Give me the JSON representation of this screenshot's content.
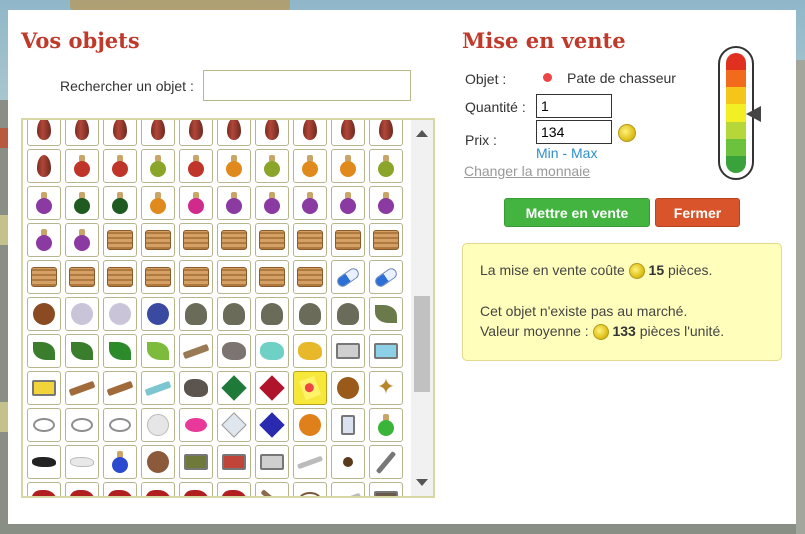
{
  "left_panel": {
    "title": "Vos objets",
    "search_label": "Rechercher un objet :",
    "search_value": ""
  },
  "grid": {
    "items": [
      "seed",
      "seed",
      "seed",
      "seed",
      "seed",
      "seed",
      "seed",
      "seed",
      "seed",
      "seed",
      "seed",
      "potion-red",
      "potion-red",
      "potion-green",
      "potion-red",
      "potion-orange",
      "potion-green",
      "potion-orange",
      "potion-orange",
      "potion-green",
      "potion-purple",
      "potion-darkgreen",
      "potion-darkgreen",
      "potion-orange",
      "potion-pink",
      "potion-purple",
      "potion-purple",
      "potion-purple",
      "potion-purple",
      "potion-purple",
      "potion-purple",
      "potion-purple",
      "scroll",
      "scroll",
      "scroll",
      "scroll",
      "scroll",
      "scroll",
      "scroll",
      "scroll",
      "scroll",
      "scroll",
      "scroll",
      "scroll",
      "scroll",
      "scroll",
      "scroll",
      "scroll",
      "pill",
      "pill",
      "moose",
      "sheep",
      "sheep",
      "flag-animal",
      "hedgehog",
      "hedgehog",
      "hedgehog",
      "hedgehog",
      "hedgehog",
      "branch",
      "leaf",
      "leaf",
      "clover",
      "lily",
      "sticks",
      "rock-gray",
      "rock-teal",
      "gold-nugget",
      "tray-gray",
      "tray-blue",
      "tray-yellow",
      "spoon",
      "spoon",
      "spoon-blue",
      "rock-dark",
      "gem-green",
      "gem-red",
      "paper-selected",
      "lion-medal",
      "star-flower",
      "ring",
      "ring",
      "ring",
      "pearl",
      "candy",
      "diamond",
      "gem-blue",
      "gem-orange",
      "candle",
      "flask-green",
      "powder-black",
      "powder-white",
      "flask-blue",
      "bowl",
      "tray-green",
      "tray-red",
      "tray-gray",
      "bar",
      "seeds",
      "pen",
      "red-cloth",
      "red-cloth",
      "red-cloth",
      "red-cloth",
      "red-cloth",
      "red-cloth",
      "pickaxe",
      "horseshoe",
      "bar",
      "book"
    ],
    "selected_index": 77
  },
  "right_panel": {
    "title": "Mise en vente",
    "objet_label": "Objet :",
    "objet_name": "Pate de chasseur",
    "objet_icon": "yellow-paper-icon",
    "quantite_label": "Quantité :",
    "quantite_value": "1",
    "prix_label": "Prix :",
    "prix_value": "134",
    "min_label": "Min",
    "separator": "-",
    "max_label": "Max",
    "change_currency": "Changer la monnaie",
    "sell_button": "Mettre en vente",
    "close_button": "Fermer",
    "gauge_colors": [
      "#e03020",
      "#f26b1d",
      "#f6c51a",
      "#f2ef24",
      "#b6d73a",
      "#6cc23c",
      "#3aa23a"
    ],
    "gauge_level_fraction": 0.45
  },
  "info": {
    "fee_prefix": "La mise en vente coûte",
    "fee_amount": "15",
    "fee_suffix": "pièces.",
    "market_text": "Cet objet n'existe pas au marché.",
    "avg_prefix": "Valeur moyenne :",
    "avg_amount": "133",
    "avg_suffix": "pièces l'unité."
  }
}
